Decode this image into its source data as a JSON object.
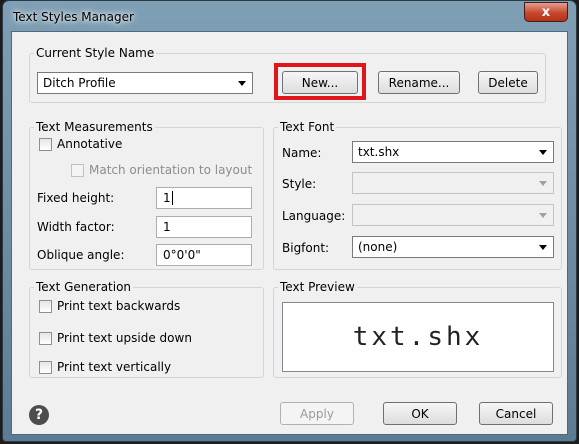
{
  "window": {
    "title": "Text Styles Manager",
    "close_glyph": "x"
  },
  "current_style": {
    "group_label": "Current Style Name",
    "selected": "Ditch Profile",
    "new_label": "New...",
    "rename_label": "Rename...",
    "delete_label": "Delete",
    "highlight_color": "#e0161b"
  },
  "measurements": {
    "group_label": "Text Measurements",
    "annotative_label": "Annotative",
    "annotative_checked": false,
    "match_orientation_label": "Match orientation to layout",
    "fixed_height_label": "Fixed height:",
    "fixed_height_value": "1",
    "width_factor_label": "Width factor:",
    "width_factor_value": "1",
    "oblique_angle_label": "Oblique angle:",
    "oblique_angle_value": "0°0'0\""
  },
  "font": {
    "group_label": "Text Font",
    "name_label": "Name:",
    "name_value": "txt.shx",
    "style_label": "Style:",
    "style_value": "",
    "language_label": "Language:",
    "language_value": "",
    "bigfont_label": "Bigfont:",
    "bigfont_value": "(none)"
  },
  "generation": {
    "group_label": "Text Generation",
    "backwards_label": "Print text backwards",
    "upside_down_label": "Print text upside down",
    "vertically_label": "Print text vertically"
  },
  "preview": {
    "group_label": "Text Preview",
    "sample_text": "txt.shx"
  },
  "footer": {
    "help_glyph": "?",
    "apply_label": "Apply",
    "ok_label": "OK",
    "cancel_label": "Cancel"
  }
}
